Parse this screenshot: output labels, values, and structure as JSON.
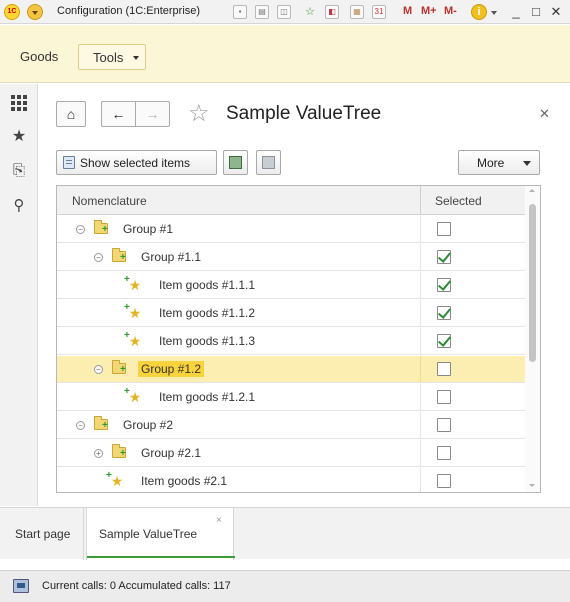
{
  "window": {
    "logo": "1C",
    "title": "Configuration  (1C:Enterprise)",
    "memory_buttons": [
      "M",
      "M+",
      "M-"
    ],
    "info_symbol": "i",
    "controls": [
      "_",
      "□",
      "✕"
    ]
  },
  "sections": {
    "goods": "Goods",
    "tools": "Tools"
  },
  "sidebar": {
    "icons": [
      "apps-grid-icon",
      "star-icon",
      "history-icon",
      "search-icon"
    ]
  },
  "form": {
    "title": "Sample ValueTree",
    "show_selected_label": "Show selected items",
    "more_label": "More"
  },
  "tree": {
    "columns": {
      "nomenclature": "Nomenclature",
      "selected": "Selected"
    },
    "rows": [
      {
        "label": "Group #1",
        "type": "group",
        "level": 0,
        "expander": "−",
        "checked": false
      },
      {
        "label": "Group #1.1",
        "type": "group",
        "level": 1,
        "expander": "−",
        "checked": true
      },
      {
        "label": "Item goods #1.1.1",
        "type": "item",
        "level": 2,
        "checked": true
      },
      {
        "label": "Item goods #1.1.2",
        "type": "item",
        "level": 2,
        "checked": true
      },
      {
        "label": "Item goods #1.1.3",
        "type": "item",
        "level": 2,
        "checked": true
      },
      {
        "label": "Group #1.2",
        "type": "group",
        "level": 1,
        "expander": "−",
        "checked": false,
        "selected": true
      },
      {
        "label": "Item goods #1.2.1",
        "type": "item",
        "level": 2,
        "checked": false
      },
      {
        "label": "Group #2",
        "type": "group",
        "level": 0,
        "expander": "−",
        "checked": false
      },
      {
        "label": "Group #2.1",
        "type": "group",
        "level": 1,
        "expander": "+",
        "checked": false
      },
      {
        "label": "Item goods #2.1",
        "type": "item",
        "level": 1,
        "checked": false
      }
    ]
  },
  "tabs": {
    "start": "Start page",
    "sample": "Sample ValueTree",
    "close": "×"
  },
  "status": {
    "text": "Current calls: 0   Accumulated calls: 117"
  },
  "colors": {
    "sections_bg": "#fbf6d6",
    "selected_row_bg": "#fbeeb0",
    "highlight": "#f8d33d",
    "check_green": "#2e8b3c",
    "active_tab_accent": "#3a9d3a"
  }
}
